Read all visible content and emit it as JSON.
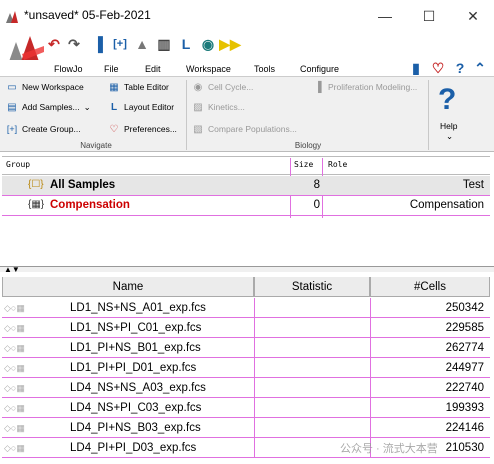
{
  "window": {
    "title": "*unsaved* 05-Feb-2021"
  },
  "menu": [
    "FlowJo",
    "File",
    "Edit",
    "Workspace",
    "Tools",
    "Configure"
  ],
  "ribbon": {
    "navigate": {
      "label": "Navigate",
      "new_workspace": "New Workspace",
      "add_samples": "Add Samples...",
      "create_group": "Create Group..."
    },
    "editors": {
      "table_editor": "Table Editor",
      "layout_editor": "Layout Editor",
      "preferences": "Preferences..."
    },
    "biology": {
      "label": "Biology",
      "cell_cycle": "Cell Cycle...",
      "kinetics": "Kinetics...",
      "compare_populations": "Compare Populations...",
      "proliferation": "Proliferation Modeling..."
    },
    "help": {
      "label": "Help"
    }
  },
  "groups": {
    "headers": {
      "group": "Group",
      "size": "Size",
      "role": "Role"
    },
    "rows": [
      {
        "name": "All Samples",
        "size": "8",
        "role": "Test"
      },
      {
        "name": "Compensation",
        "size": "0",
        "role": "Compensation"
      }
    ]
  },
  "samples": {
    "headers": {
      "name": "Name",
      "statistic": "Statistic",
      "cells": "#Cells"
    },
    "rows": [
      {
        "name": "LD1_NS+NS_A01_exp.fcs",
        "statistic": "",
        "cells": "250342"
      },
      {
        "name": "LD1_NS+PI_C01_exp.fcs",
        "statistic": "",
        "cells": "229585"
      },
      {
        "name": "LD1_PI+NS_B01_exp.fcs",
        "statistic": "",
        "cells": "262774"
      },
      {
        "name": "LD1_PI+PI_D01_exp.fcs",
        "statistic": "",
        "cells": "244977"
      },
      {
        "name": "LD4_NS+NS_A03_exp.fcs",
        "statistic": "",
        "cells": "222740"
      },
      {
        "name": "LD4_NS+PI_C03_exp.fcs",
        "statistic": "",
        "cells": "199393"
      },
      {
        "name": "LD4_PI+NS_B03_exp.fcs",
        "statistic": "",
        "cells": "224146"
      },
      {
        "name": "LD4_PI+PI_D03_exp.fcs",
        "statistic": "",
        "cells": "210530"
      }
    ]
  },
  "watermark": "公众号 · 流式大本营",
  "colors": {
    "compensation_text": "#cc0000",
    "row_border": "#e070e0",
    "ribbon_bg": "#f0f0f0",
    "help_blue": "#1b5fa8"
  }
}
